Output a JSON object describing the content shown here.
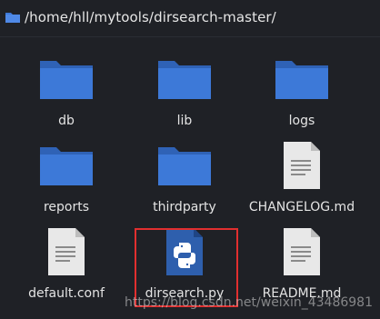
{
  "path": "/home/hll/mytools/dirsearch-master/",
  "items": [
    {
      "name": "db",
      "type": "folder"
    },
    {
      "name": "lib",
      "type": "folder"
    },
    {
      "name": "logs",
      "type": "folder"
    },
    {
      "name": "reports",
      "type": "folder"
    },
    {
      "name": "thirdparty",
      "type": "folder"
    },
    {
      "name": "CHANGELOG.md",
      "type": "text-file"
    },
    {
      "name": "default.conf",
      "type": "text-file"
    },
    {
      "name": "dirsearch.py",
      "type": "python-file",
      "selected": true
    },
    {
      "name": "README.md",
      "type": "text-file"
    }
  ],
  "watermark": "https://blog.csdn.net/weixin_43486981",
  "colors": {
    "background": "#1f2126",
    "folder": "#3d79d8",
    "text_file": "#e6e6e6",
    "python_file": "#2e5fad",
    "highlight_box": "#e12f2f"
  }
}
